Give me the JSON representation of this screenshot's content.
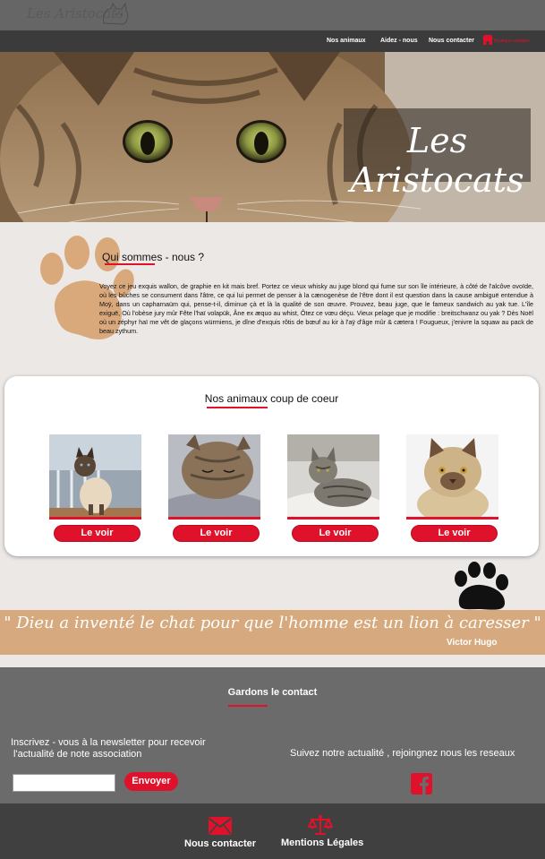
{
  "header": {
    "logo_text": "Les Aristocats"
  },
  "nav": {
    "items": [
      "Nos animaux",
      "Aidez - nous",
      "Nous contacter"
    ],
    "store_label": "Boutique solidaire"
  },
  "hero": {
    "title": "Les Aristocats"
  },
  "about": {
    "title": "Qui sommes - nous ?",
    "text": "Voyez ce jeu exquis wallon, de graphie en kit mais bref. Portez ce vieux whisky au juge blond qui fume sur son île intérieure, à côté de l'alcôve ovoïde, où les bûches se consument dans l'âtre, ce qui lui permet de penser à la cænogenèse de l'être dont il est question dans la cause ambiguë entendue à Moÿ, dans un capharnaüm qui, pense-t-il, diminue çà et là la qualité de son œuvre. Prouvez, beau juge, que le fameux sandwich au yak tue. L'île exiguë, Où l'obèse jury mûr Fête l'haï volapük, Âne ex æquo au whist, Ôtez ce vœu déçu. Vieux pelage que je modifie : breitschwanz ou yak ? Dès Noël où un zéphyr haï me vêt de glaçons würmiens, je dîne d'exquis rôtis de bœuf au kir à l'aÿ d'âge mûr & cætera ! Fougueux, j'enivre la squaw au pack de beau zythum."
  },
  "favorites": {
    "title": "Nos animaux coup de coeur",
    "cards": [
      {
        "button": "Le voir",
        "photo": "siamese-cat"
      },
      {
        "button": "Le voir",
        "photo": "sleeping-tabby-cat"
      },
      {
        "button": "Le voir",
        "photo": "grey-tabby-cat"
      },
      {
        "button": "Le voir",
        "photo": "british-shorthair-cat"
      }
    ]
  },
  "quote": {
    "text": "\" Dieu a inventé le chat pour que l'homme est un lion à caresser \"",
    "author": "Victor Hugo"
  },
  "contact": {
    "title": "Gardons le contact",
    "newsletter_line1": "Inscrivez - vous à la newsletter pour recevoir",
    "newsletter_line2": " l'actualité de note association",
    "input_value": "",
    "send_label": "Envoyer",
    "social_text": "Suivez notre actualité , rejoingnez nous les reseaux"
  },
  "footer": {
    "contact_label": "Nous contacter",
    "legal_label": "Mentions Légales"
  },
  "colors": {
    "accent": "#e0112b",
    "nav_bg": "#3b3b3b",
    "quote_band": "#d6aa7e",
    "contact_bg": "#6b6b6b",
    "footer_bg": "#404040",
    "paw_tan": "#d9a97c"
  }
}
